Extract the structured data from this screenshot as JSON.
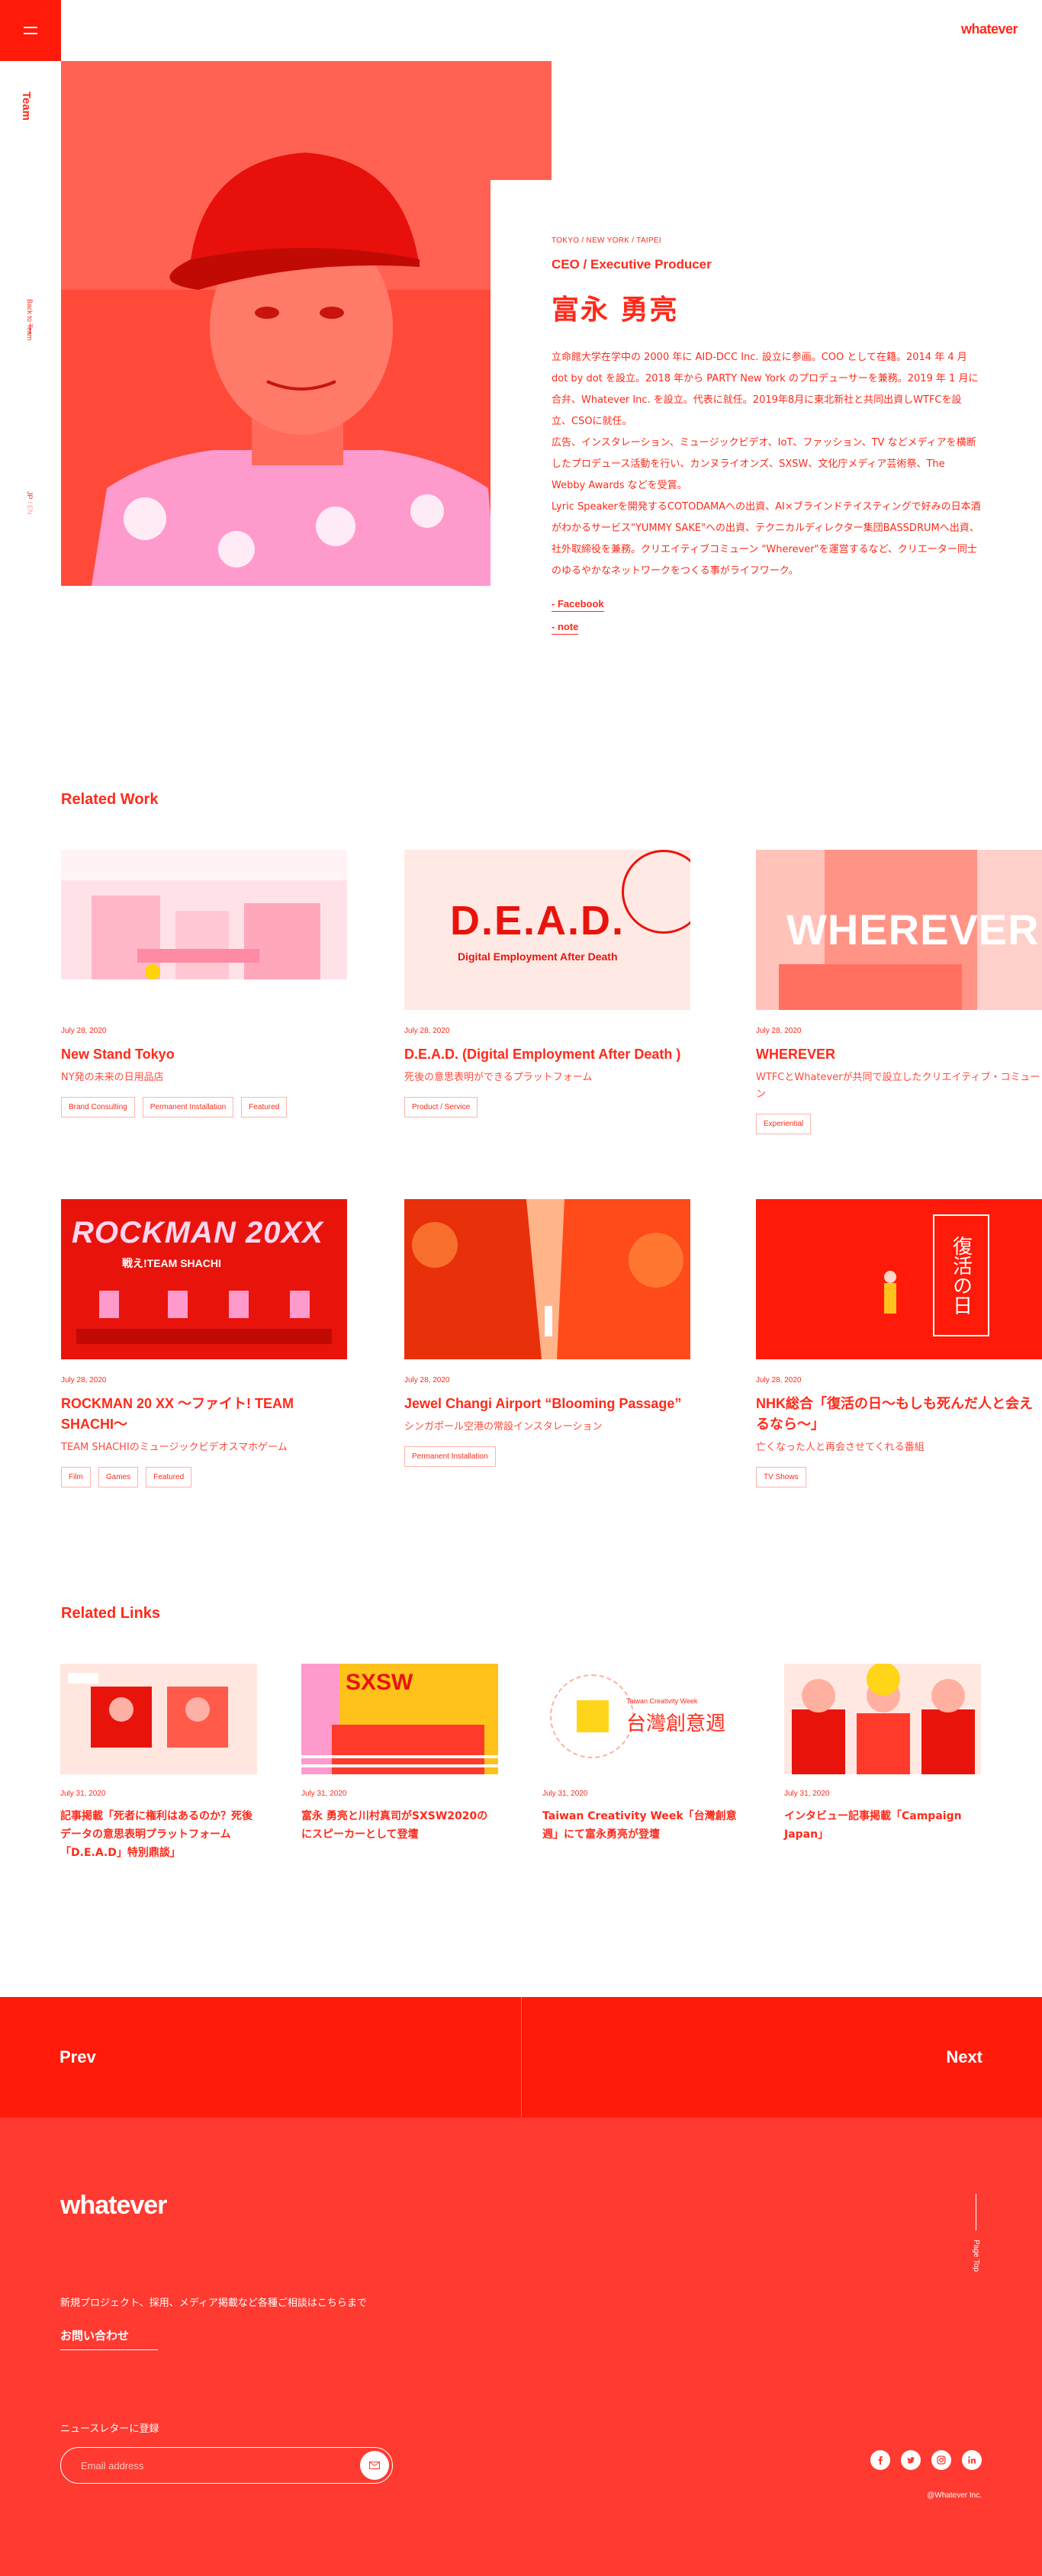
{
  "header": {
    "logo": "whatever",
    "menu_icon": "hamburger-icon"
  },
  "rail": {
    "section": "Team",
    "back": "Back to Team",
    "lang_jp": "JP",
    "lang_sep": " / ",
    "lang_en": "EN"
  },
  "profile": {
    "locations": "TOKYO / NEW YORK / TAIPEI",
    "role": "CEO / Executive Producer",
    "name": "富永 勇亮",
    "bio": [
      "立命館大学在学中の 2000 年に AID-DCC Inc. 設立に参画。COO として在籍。2014 年 4 月 dot by dot を設立。2018 年から PARTY New York のプロデューサーを兼務。2019 年 1 月に合弁、Whatever Inc. を設立。代表に就任。2019年8月に東北新社と共同出資しWTFCを設立、CSOに就任。",
      "広告、インスタレーション、ミュージックビデオ、IoT、ファッション、TV などメディアを横断したプロデュース活動を行い、カンヌライオンズ、SXSW、文化庁メディア芸術祭、The Webby Awards などを受賞。",
      "Lyric Speakerを開発するCOTODAMAへの出資、AI×ブラインドテイスティングで好みの日本酒がわかるサービス\"YUMMY SAKE\"への出資、テクニカルディレクター集団BASSDRUMへ出資、社外取締役を兼務。クリエイティブコミューン \"Wherever\"を運営するなど、クリエーター同士のゆるやかなネットワークをつくる事がライフワーク。"
    ],
    "links": [
      "- Facebook",
      "- note"
    ]
  },
  "related_work": {
    "title": "Related Work",
    "items": [
      {
        "date": "July 28, 2020",
        "title": "New Stand Tokyo",
        "desc": "NY発の未来の日用品店",
        "tags": [
          "Brand Consulting",
          "Permanent Installation",
          "Featured"
        ]
      },
      {
        "date": "July 28, 2020",
        "title": "D.E.A.D. (Digital Employment After Death )",
        "desc": "死後の意思表明ができるプラットフォーム",
        "tags": [
          "Product / Service"
        ],
        "thumb_text": "D.E.A.D.",
        "thumb_sub": "Digital Employment After Death"
      },
      {
        "date": "July 28, 2020",
        "title": "WHEREVER",
        "desc": "WTFCとWhateverが共同で設立したクリエイティブ・コミューン",
        "tags": [
          "Experiential"
        ],
        "thumb_text": "WHEREVER"
      },
      {
        "date": "July 28, 2020",
        "title": "ROCKMAN 20 XX 〜ファイト! TEAM SHACHI〜",
        "desc": "TEAM SHACHIのミュージックビデオスマホゲーム",
        "tags": [
          "Film",
          "Games",
          "Featured"
        ],
        "thumb_text": "ROCKMAN 20XX",
        "thumb_sub": "戦え!TEAM SHACHI"
      },
      {
        "date": "July 28, 2020",
        "title": "Jewel Changi Airport “Blooming Passage”",
        "desc": "シンガポール空港の常設インスタレーション",
        "tags": [
          "Permanent Installation"
        ]
      },
      {
        "date": "July 28, 2020",
        "title": "NHK総合「復活の日〜もしも死んだ人と会えるなら〜」",
        "desc": "亡くなった人と再会させてくれる番組",
        "tags": [
          "TV Shows"
        ],
        "thumb_text": "復活の日"
      }
    ]
  },
  "related_links": {
    "title": "Related Links",
    "items": [
      {
        "date": "July 31, 2020",
        "title": "記事掲載「死者に権利はあるのか？死後データの意思表明プラットフォーム「D.E.A.D」特別鼎談」"
      },
      {
        "date": "July 31, 2020",
        "title": "富永 勇亮と川村真司がSXSW2020のにスピーカーとして登壇",
        "thumb_text": "SXSW"
      },
      {
        "date": "July 31, 2020",
        "title": "Taiwan Creativity Week「台灣創意週」にて富永勇亮が登壇",
        "thumb_text": "台灣創意週",
        "thumb_sub": "Taiwan Creativity Week"
      },
      {
        "date": "July 31, 2020",
        "title": "インタビュー記事掲載「Campaign Japan」"
      }
    ]
  },
  "pager": {
    "prev": "Prev",
    "next": "Next"
  },
  "footer": {
    "logo": "whatever",
    "note": "新規プロジェクト、採用、メディア掲載など各種ご相談はこちらまで",
    "contact": "お問い合わせ",
    "newsletter_label": "ニュースレターに登録",
    "email_placeholder": "Email address",
    "page_top": "Page Top",
    "social_icons": [
      "facebook-icon",
      "twitter-icon",
      "instagram-icon",
      "linkedin-icon"
    ],
    "copyright": "@Whatever Inc."
  },
  "colors": {
    "accent": "#ff2a1a",
    "footer_bg": "#ff3a30",
    "pager_bg": "#ff1a0a"
  }
}
